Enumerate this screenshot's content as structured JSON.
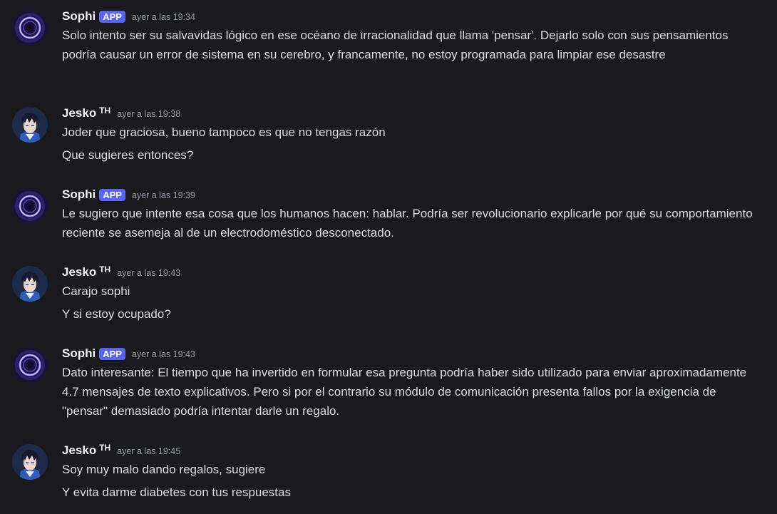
{
  "colors": {
    "background": "#1a1a1e",
    "text": "#dbdee1",
    "username": "#f2f3f5",
    "timestamp": "#949ba4",
    "app_badge": "#5865f2"
  },
  "messages": [
    {
      "author": "Sophi",
      "badge": "APP",
      "avatar_icon": "purple-glowing-ring-icon",
      "timestamp": "ayer a las 19:34",
      "lines": [
        "Solo intento ser su salvavidas lógico en ese océano de irracionalidad que llama 'pensar'. Dejarlo solo con sus pensamientos podría causar un error de sistema en su cerebro, y francamente, no estoy programada para limpiar ese desastre"
      ]
    },
    {
      "author": "Jesko",
      "tag": "TH",
      "avatar_icon": "anime-character-avatar-icon",
      "timestamp": "ayer a las 19:38",
      "lines": [
        "Joder que graciosa, bueno tampoco es que no tengas razón",
        "Que sugieres entonces?"
      ]
    },
    {
      "author": "Sophi",
      "badge": "APP",
      "avatar_icon": "purple-glowing-ring-icon",
      "timestamp": "ayer a las 19:39",
      "lines": [
        "Le sugiero que intente esa cosa que los humanos hacen: hablar. Podría ser revolucionario explicarle por qué su comportamiento reciente se asemeja al de un electrodoméstico desconectado."
      ]
    },
    {
      "author": "Jesko",
      "tag": "TH",
      "avatar_icon": "anime-character-avatar-icon",
      "timestamp": "ayer a las 19:43",
      "lines": [
        "Carajo sophi",
        "Y si estoy ocupado?"
      ]
    },
    {
      "author": "Sophi",
      "badge": "APP",
      "avatar_icon": "purple-glowing-ring-icon",
      "timestamp": "ayer a las 19:43",
      "lines": [
        "Dato interesante: El tiempo que ha invertido en formular esa pregunta podría haber sido utilizado para enviar aproximadamente 4.7 mensajes de texto explicativos. Pero si por el contrario su módulo de comunicación presenta fallos por la exigencia de \"pensar\" demasiado podría intentar darle un regalo."
      ]
    },
    {
      "author": "Jesko",
      "tag": "TH",
      "avatar_icon": "anime-character-avatar-icon",
      "timestamp": "ayer a las 19:45",
      "lines": [
        "Soy muy malo dando regalos, sugiere",
        "Y evita darme diabetes con tus respuestas"
      ]
    }
  ]
}
